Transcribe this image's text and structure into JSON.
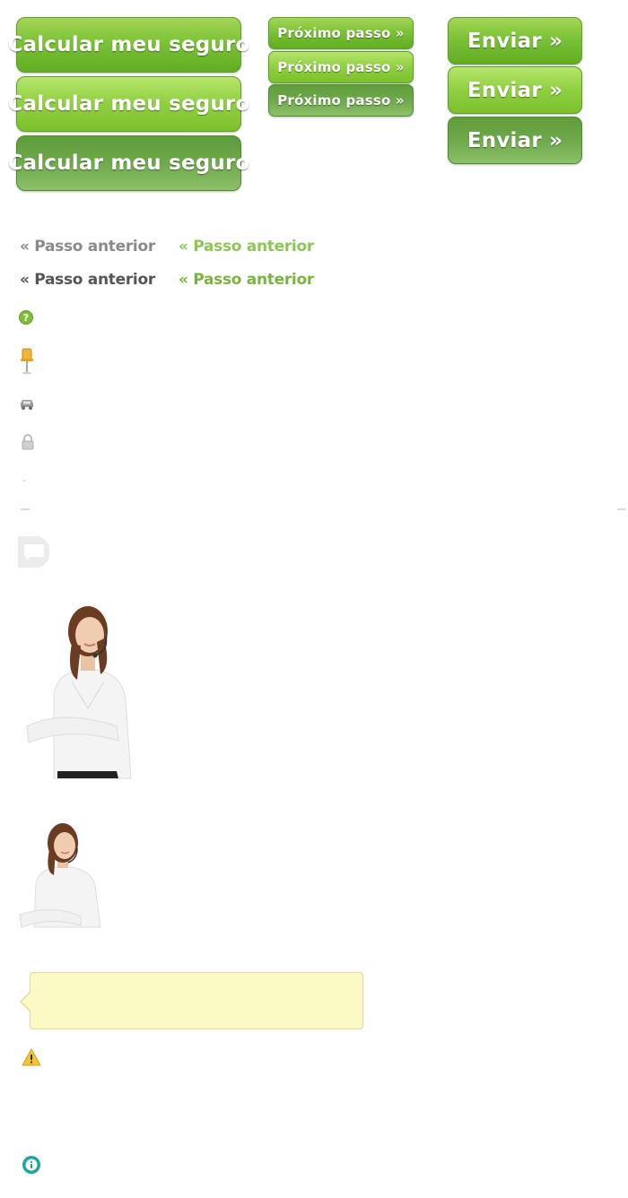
{
  "buttons": {
    "calcular_label": "Calcular meu seguro",
    "proximo_label": "Próximo passo »",
    "enviar_label": "Enviar »"
  },
  "prev_links": {
    "label": "« Passo anterior"
  },
  "colors": {
    "green_normal": "#78c035",
    "green_hover": "#8fcf40",
    "green_active": "#6ea94b",
    "link_gray": "#8a8a8a",
    "link_dark": "#555555",
    "link_green": "#8cc654",
    "tooltip_bg": "#fbfac4"
  },
  "icons": {
    "help": "question-circle-icon",
    "pin": "push-pin-icon",
    "car": "car-icon",
    "lock": "lock-icon",
    "chat": "chat-bubble-icon",
    "warning": "warning-icon",
    "info": "info-icon"
  }
}
